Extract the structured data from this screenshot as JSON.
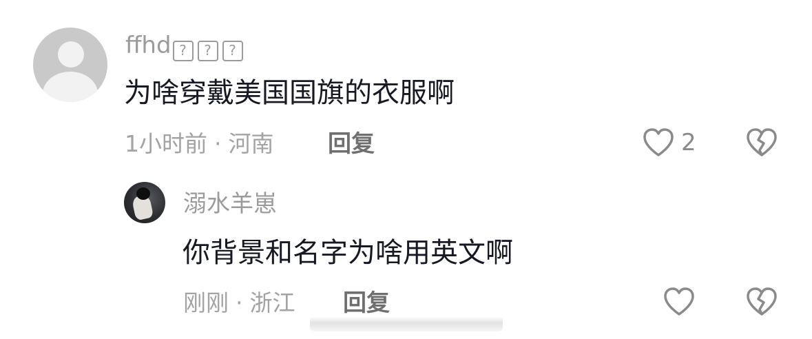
{
  "comments": [
    {
      "username": "ffhd",
      "username_suffix_boxes": [
        "?",
        "?",
        "?"
      ],
      "text": "为啥穿戴美国国旗的衣服啊",
      "time": "1小时前",
      "separator": "·",
      "location": "河南",
      "reply_label": "回复",
      "like_count": "2",
      "avatar_icon": "default-user-icon"
    }
  ],
  "replies": [
    {
      "username": "溺水羊崽",
      "text": "你背景和名字为啥用英文啊",
      "time": "刚刚",
      "separator": "·",
      "location": "浙江",
      "reply_label": "回复",
      "avatar_icon": "photo-avatar"
    }
  ],
  "icons": {
    "like": "heart-outline-icon",
    "dislike": "broken-heart-icon"
  },
  "colors": {
    "background": "#ffffff",
    "username": "#9b9b9b",
    "text": "#161823",
    "meta": "#a3a3a3",
    "reply": "#6f6f6f",
    "icon": "#8a8a8a"
  }
}
